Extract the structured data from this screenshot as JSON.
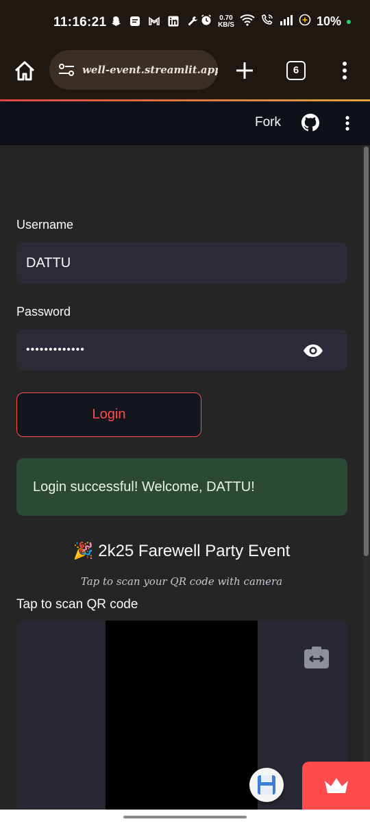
{
  "status_bar": {
    "time": "11:16:21",
    "net_speed_value": "0.70",
    "net_speed_unit": "KB/S",
    "battery": "10%",
    "icons": [
      "snapchat-icon",
      "note-icon",
      "gmail-icon",
      "linkedin-icon",
      "wrench-icon",
      "alarm-icon",
      "wifi-icon",
      "wifi-call-icon",
      "signal-icon",
      "battery-saver-icon"
    ]
  },
  "browser": {
    "url": "well-event.streamlit.app",
    "tab_count": "6"
  },
  "header": {
    "fork_label": "Fork"
  },
  "form": {
    "username_label": "Username",
    "username_value": "DATTU",
    "password_label": "Password",
    "password_value": "•••••••••••••",
    "login_label": "Login"
  },
  "alert": {
    "message": "Login successful! Welcome, DATTU!"
  },
  "event": {
    "emoji": "🎉",
    "title": "2k25 Farewell Party Event",
    "subtitle": "Tap to scan your QR code with camera",
    "scan_label": "Tap to scan QR code"
  },
  "colors": {
    "accent": "#ff4b4b",
    "success_bg": "#2a4a36",
    "app_bg": "#252526",
    "input_bg": "#2a2b36"
  }
}
